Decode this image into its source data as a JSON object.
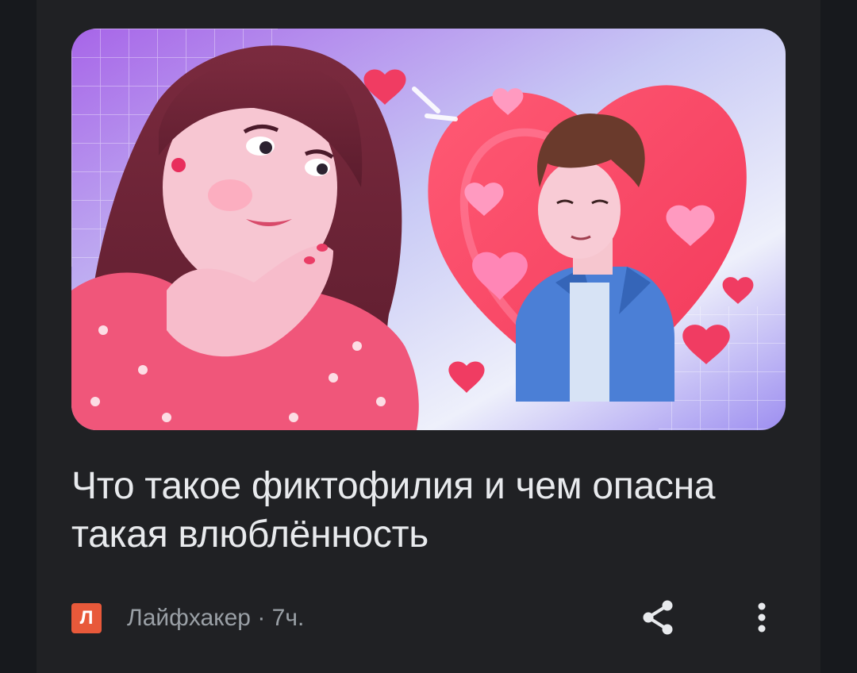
{
  "article": {
    "headline": "Что такое фиктофилия и чем опасна такая влюблённость",
    "source_logo_letter": "Л",
    "source_name": "Лайфхакер",
    "separator": " · ",
    "age": "7ч."
  },
  "image": {
    "description_icon": "illustration-girl-daydreaming-about-boy-in-heart"
  },
  "actions": {
    "share_icon": "share-icon",
    "more_icon": "more-vert-icon"
  },
  "colors": {
    "background": "#17191d",
    "card": "#202124",
    "text_primary": "#e8eaed",
    "text_secondary": "#9aa0a6",
    "source_brand": "#e8593a"
  }
}
